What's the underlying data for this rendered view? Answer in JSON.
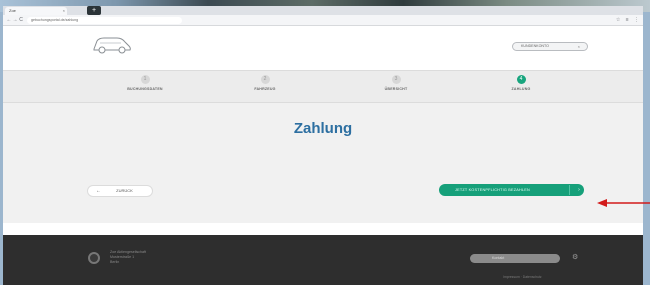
{
  "browser": {
    "tab_title": "Zoe",
    "tab_close": "×",
    "new_tab": "+",
    "url": "gebuchungsportal.de/zahlung",
    "back": "←",
    "forward": "→",
    "reload": "C",
    "menu_icons": [
      "☆",
      "≡",
      "⋮"
    ]
  },
  "header": {
    "account_label": "KUNDENKONTO",
    "account_close": "×"
  },
  "steps": [
    {
      "icon": "1",
      "label": "BUCHUNGSDATEN"
    },
    {
      "icon": "2",
      "label": "FAHRZEUG"
    },
    {
      "icon": "3",
      "label": "ÜBERSICHT"
    },
    {
      "icon": "4",
      "label": "ZAHLUNG"
    }
  ],
  "main": {
    "title": "Zahlung",
    "back_arrow": "←",
    "back_label": "ZURÜCK",
    "pay_label": "JETZT KOSTENPFLICHTIG BEZAHLEN",
    "pay_chevron": "›"
  },
  "footer": {
    "text_lines": [
      "Zoe Aktiengesellschaft",
      "Musterstraße 1",
      "Berlin"
    ],
    "pill_label": "Kontakt",
    "icon": "⚙",
    "bottom_text": "Impressum · Datenschutz"
  },
  "colors": {
    "accent_green": "#18a57e",
    "heading_blue": "#2d6fa1",
    "annotation_red": "#d21a1a"
  }
}
